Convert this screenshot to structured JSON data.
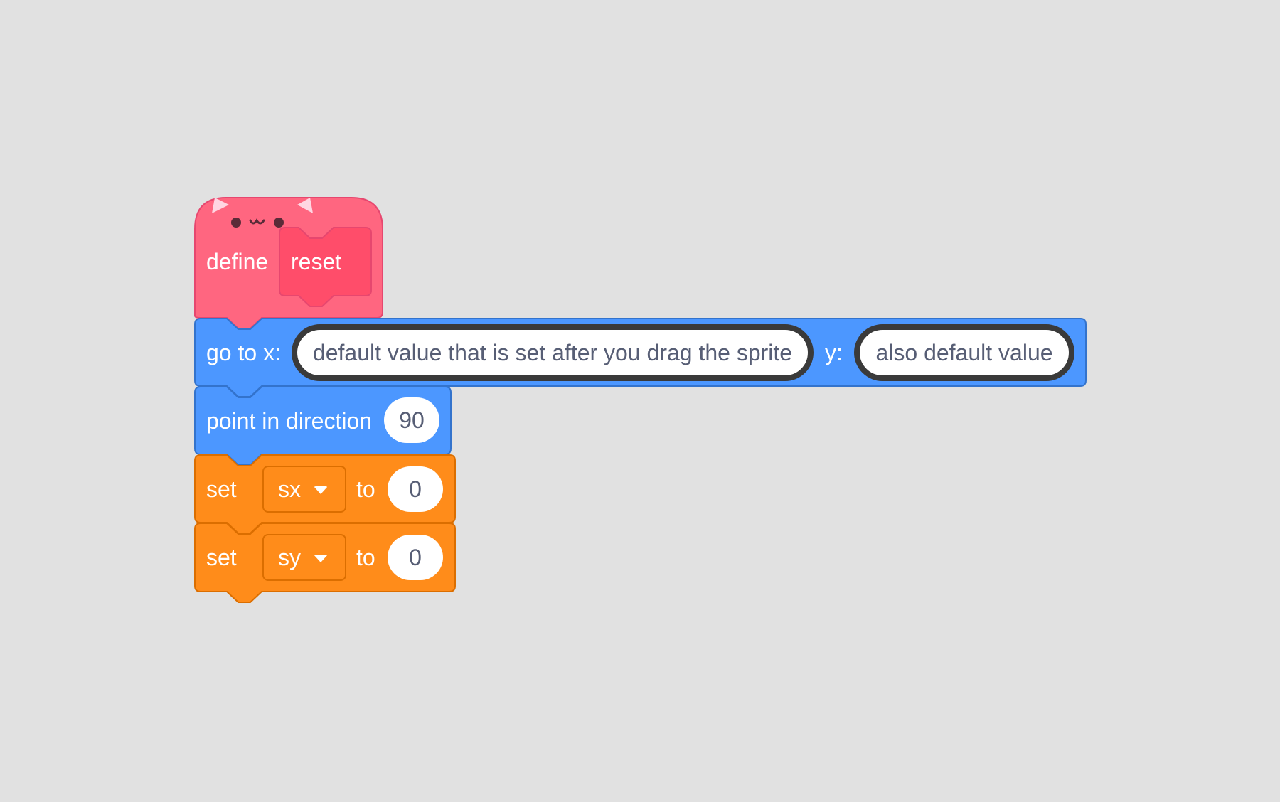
{
  "script": {
    "define_block": {
      "keyword": "define",
      "name": "reset",
      "color": "#ff6680",
      "face": "• ω •"
    },
    "goto_block": {
      "label_x": "go to x:",
      "x_value": "default value that is set after you drag the sprite",
      "label_y": "y:",
      "y_value": "also default value",
      "color": "#4c97ff"
    },
    "direction_block": {
      "label": "point in direction",
      "value": "90",
      "color": "#4c97ff"
    },
    "set_sx_block": {
      "label": "set",
      "variable": "sx",
      "to_label": "to",
      "value": "0",
      "color": "#ff8c1a"
    },
    "set_sy_block": {
      "label": "set",
      "variable": "sy",
      "to_label": "to",
      "value": "0",
      "color": "#ff8c1a"
    }
  }
}
